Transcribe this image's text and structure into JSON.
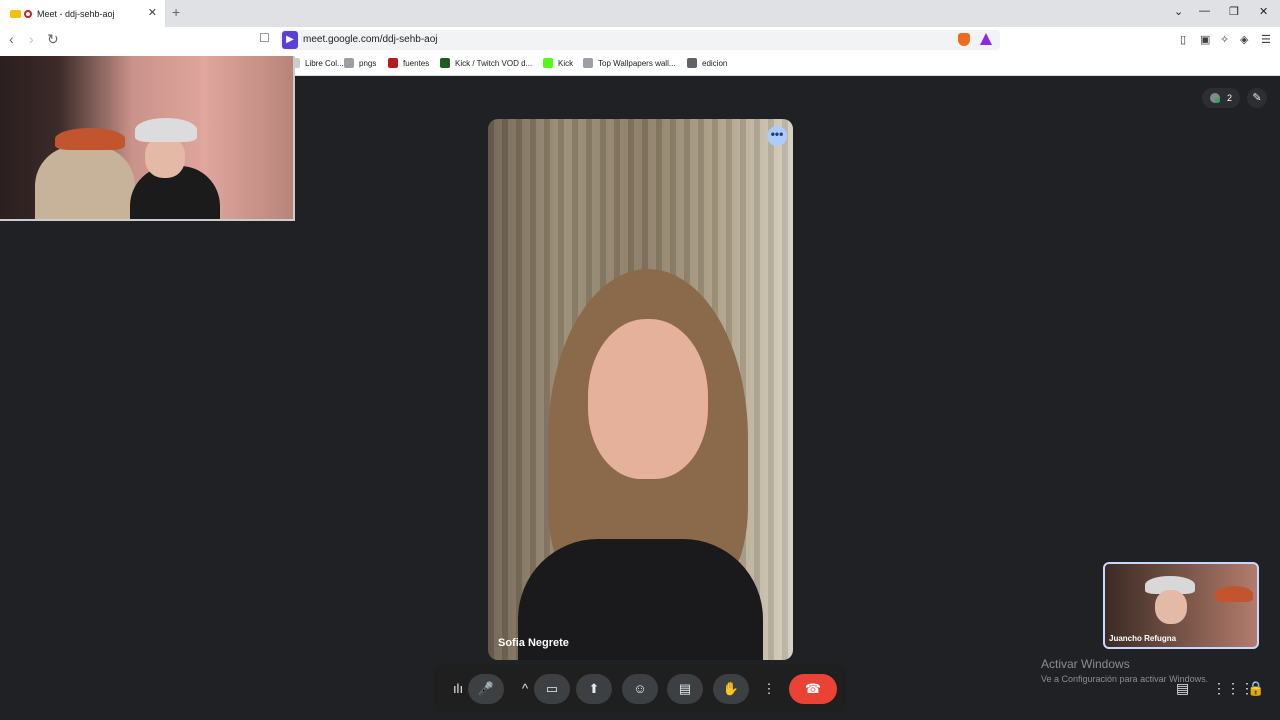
{
  "tab": {
    "title": "Meet - ddj-sehb-aoj",
    "close": "✕",
    "new_tab": "+"
  },
  "window_controls": {
    "dropdown": "⌄",
    "minimize": "—",
    "restore": "❐",
    "close": "✕"
  },
  "toolbar": {
    "back": "‹",
    "forward": "›",
    "reload": "↻",
    "bookmark": "☐",
    "url": "meet.google.com/ddj-sehb-aoj"
  },
  "bookmarks": [
    {
      "label": "Libre Col...",
      "color": "#cccccc"
    },
    {
      "label": "pngs",
      "color": "#9aa0a6"
    },
    {
      "label": "fuentes",
      "color": "#b71c1c"
    },
    {
      "label": "Kick / Twitch VOD d...",
      "color": "#1b5e20"
    },
    {
      "label": "Kick",
      "color": "#53fc18"
    },
    {
      "label": "Top Wallpapers wall...",
      "color": "#9aa0a6"
    },
    {
      "label": "edicion",
      "color": "#5f6368"
    }
  ],
  "meet": {
    "main_participant_name": "Sofia Negrete",
    "self_participant_name": "Juancho Refugna",
    "participant_count": "2",
    "more_options": "•••"
  },
  "controls": {
    "mic_level": "ılı",
    "mic": "🎤",
    "expand": "^",
    "camera": "▭",
    "present": "⬆",
    "emoji": "☺",
    "captions": "▤",
    "raise_hand": "✋",
    "more": "⋮",
    "end_call": "☎"
  },
  "watermark": {
    "line1": "Activar Windows",
    "line2": "Ve a Configuración para activar Windows."
  },
  "colors": {
    "end_call": "#ea4335",
    "meet_bg": "#202124",
    "brand": "#5b3fd6"
  }
}
